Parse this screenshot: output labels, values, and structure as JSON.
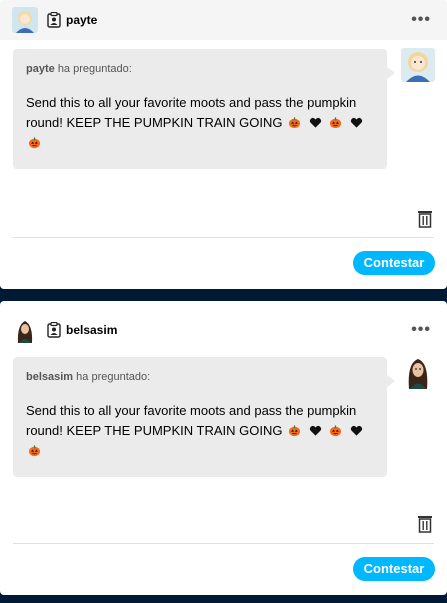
{
  "colors": {
    "background": "#001935",
    "accent": "#00b8ff",
    "bubble": "#ebebeb"
  },
  "posts": [
    {
      "username": "payte",
      "asker_name": "payte",
      "asked_label": "ha preguntado:",
      "question": "Send this to all your favorite moots and pass the pumpkin round! KEEP THE PUMPKIN TRAIN GOING",
      "emoji_trail": [
        "pumpkin",
        "black-heart",
        "pumpkin",
        "black-heart",
        "pumpkin"
      ],
      "more_label": "•••",
      "reply_label": "Contestar"
    },
    {
      "username": "belsasim",
      "asker_name": "belsasim",
      "asked_label": "ha preguntado:",
      "question": "Send this to all your favorite moots and pass the pumpkin round! KEEP THE PUMPKIN TRAIN GOING",
      "emoji_trail": [
        "pumpkin",
        "black-heart",
        "pumpkin",
        "black-heart",
        "pumpkin"
      ],
      "more_label": "•••",
      "reply_label": "Contestar"
    }
  ]
}
